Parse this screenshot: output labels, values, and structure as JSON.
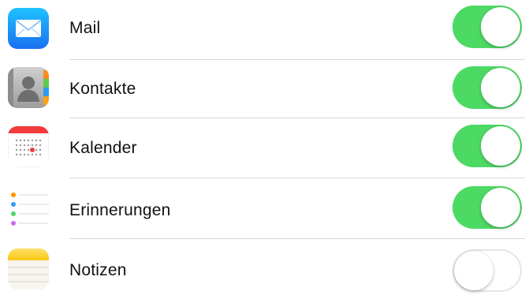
{
  "settings": {
    "items": [
      {
        "label": "Mail",
        "icon": "mail-icon",
        "enabled": true
      },
      {
        "label": "Kontakte",
        "icon": "contacts-icon",
        "enabled": true
      },
      {
        "label": "Kalender",
        "icon": "calendar-icon",
        "enabled": true
      },
      {
        "label": "Erinnerungen",
        "icon": "reminders-icon",
        "enabled": true
      },
      {
        "label": "Notizen",
        "icon": "notes-icon",
        "enabled": false
      }
    ]
  },
  "colors": {
    "toggle_on": "#4cd964",
    "toggle_off_border": "#e5e5ea",
    "divider": "#d9d9de"
  }
}
